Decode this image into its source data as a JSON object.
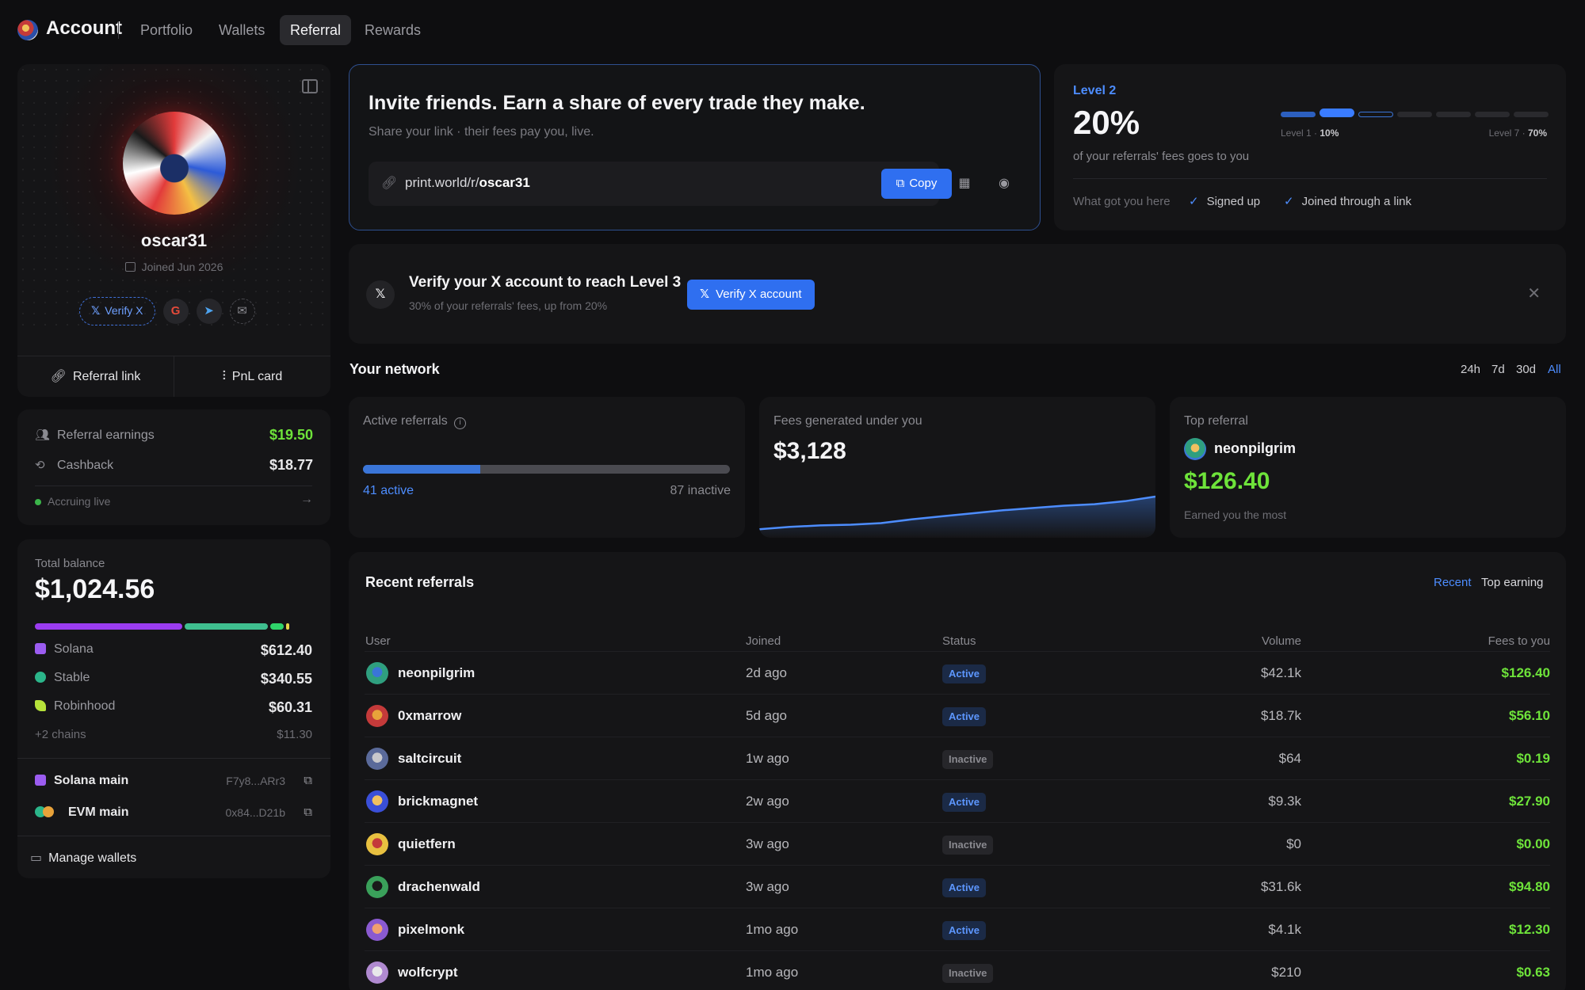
{
  "nav": {
    "brand": "Account",
    "items": [
      "Portfolio",
      "Wallets",
      "Referral",
      "Rewards"
    ],
    "active": "Referral"
  },
  "profile": {
    "username": "oscar31",
    "joined": "Joined Jun 2026",
    "verify_label": "Verify X",
    "social_icons": [
      "google-icon",
      "telegram-icon",
      "mail-icon"
    ],
    "referral_link_label": "Referral link",
    "pnl_card_label": "PnL card"
  },
  "earnings": {
    "referral_label": "Referral earnings",
    "referral_value": "$19.50",
    "cashback_label": "Cashback",
    "cashback_value": "$18.77",
    "live_label": "Accruing live"
  },
  "balance": {
    "label": "Total balance",
    "value": "$1,024.56",
    "bar_fractions": [
      0.53,
      0.3,
      0.05,
      0.01
    ],
    "bar_colors": [
      "#9b3cf0",
      "#3fbf8f",
      "#2fd46a",
      "#e8d54a"
    ],
    "chains": [
      {
        "name": "Solana",
        "value": "$612.40",
        "color": "#9b5cf0"
      },
      {
        "name": "Stable",
        "value": "$340.55",
        "color": "#2bb58a"
      },
      {
        "name": "Robinhood",
        "value": "$60.31",
        "color": "#b6e23a"
      }
    ],
    "more_label": "+2 chains",
    "more_value": "$11.30",
    "wallets": [
      {
        "name": "Solana main",
        "address": "F7y8...ARr3"
      },
      {
        "name": "EVM main",
        "address": "0x84...D21b"
      }
    ],
    "manage_label": "Manage wallets"
  },
  "invite": {
    "title": "Invite friends. Earn a share of every trade they make.",
    "subtitle": "Share your link · their fees pay you, live.",
    "link_prefix": "print.world/r/",
    "link_user": "oscar31",
    "copy_label": "Copy"
  },
  "level": {
    "name": "Level 2",
    "percent": "20%",
    "desc": "of your referrals' fees goes to you",
    "current_level": 2,
    "total_levels": 7,
    "start_label": "Level 1 · ",
    "start_pct": "10%",
    "end_label": "Level 7 · ",
    "end_pct": "70%",
    "why_label": "What got you here",
    "reasons": [
      "Signed up",
      "Joined through a link"
    ]
  },
  "verify_banner": {
    "title": "Verify your X account to reach Level 3",
    "subtitle": "30% of your referrals' fees, up from 20%",
    "button": "Verify X account"
  },
  "network": {
    "title": "Your network",
    "ranges": [
      "24h",
      "7d",
      "30d",
      "All"
    ],
    "active_range": "All",
    "active_referrals_label": "Active referrals",
    "active_count": "41 active",
    "inactive_count": "87 inactive",
    "active_fraction": 0.32,
    "fees_label": "Fees generated under you",
    "fees_value": "$3,128",
    "fees_trend": [
      5,
      8,
      10,
      11,
      13,
      18,
      22,
      26,
      30,
      33,
      36,
      38,
      42,
      48
    ],
    "top_label": "Top referral",
    "top_name": "neonpilgrim",
    "top_value": "$126.40",
    "top_note": "Earned you the most"
  },
  "recent": {
    "title": "Recent referrals",
    "tabs": [
      "Recent",
      "Top earning"
    ],
    "active_tab": "Recent",
    "columns": [
      "User",
      "Joined",
      "Status",
      "Volume",
      "Fees to you"
    ],
    "rows": [
      {
        "user": "neonpilgrim",
        "joined": "2d ago",
        "status": "Active",
        "volume": "$42.1k",
        "fees": "$126.40"
      },
      {
        "user": "0xmarrow",
        "joined": "5d ago",
        "status": "Active",
        "volume": "$18.7k",
        "fees": "$56.10"
      },
      {
        "user": "saltcircuit",
        "joined": "1w ago",
        "status": "Inactive",
        "volume": "$64",
        "fees": "$0.19"
      },
      {
        "user": "brickmagnet",
        "joined": "2w ago",
        "status": "Active",
        "volume": "$9.3k",
        "fees": "$27.90"
      },
      {
        "user": "quietfern",
        "joined": "3w ago",
        "status": "Inactive",
        "volume": "$0",
        "fees": "$0.00"
      },
      {
        "user": "drachenwald",
        "joined": "3w ago",
        "status": "Active",
        "volume": "$31.6k",
        "fees": "$94.80"
      },
      {
        "user": "pixelmonk",
        "joined": "1mo ago",
        "status": "Active",
        "volume": "$4.1k",
        "fees": "$12.30"
      },
      {
        "user": "wolfcrypt",
        "joined": "1mo ago",
        "status": "Inactive",
        "volume": "$210",
        "fees": "$0.63"
      }
    ]
  }
}
